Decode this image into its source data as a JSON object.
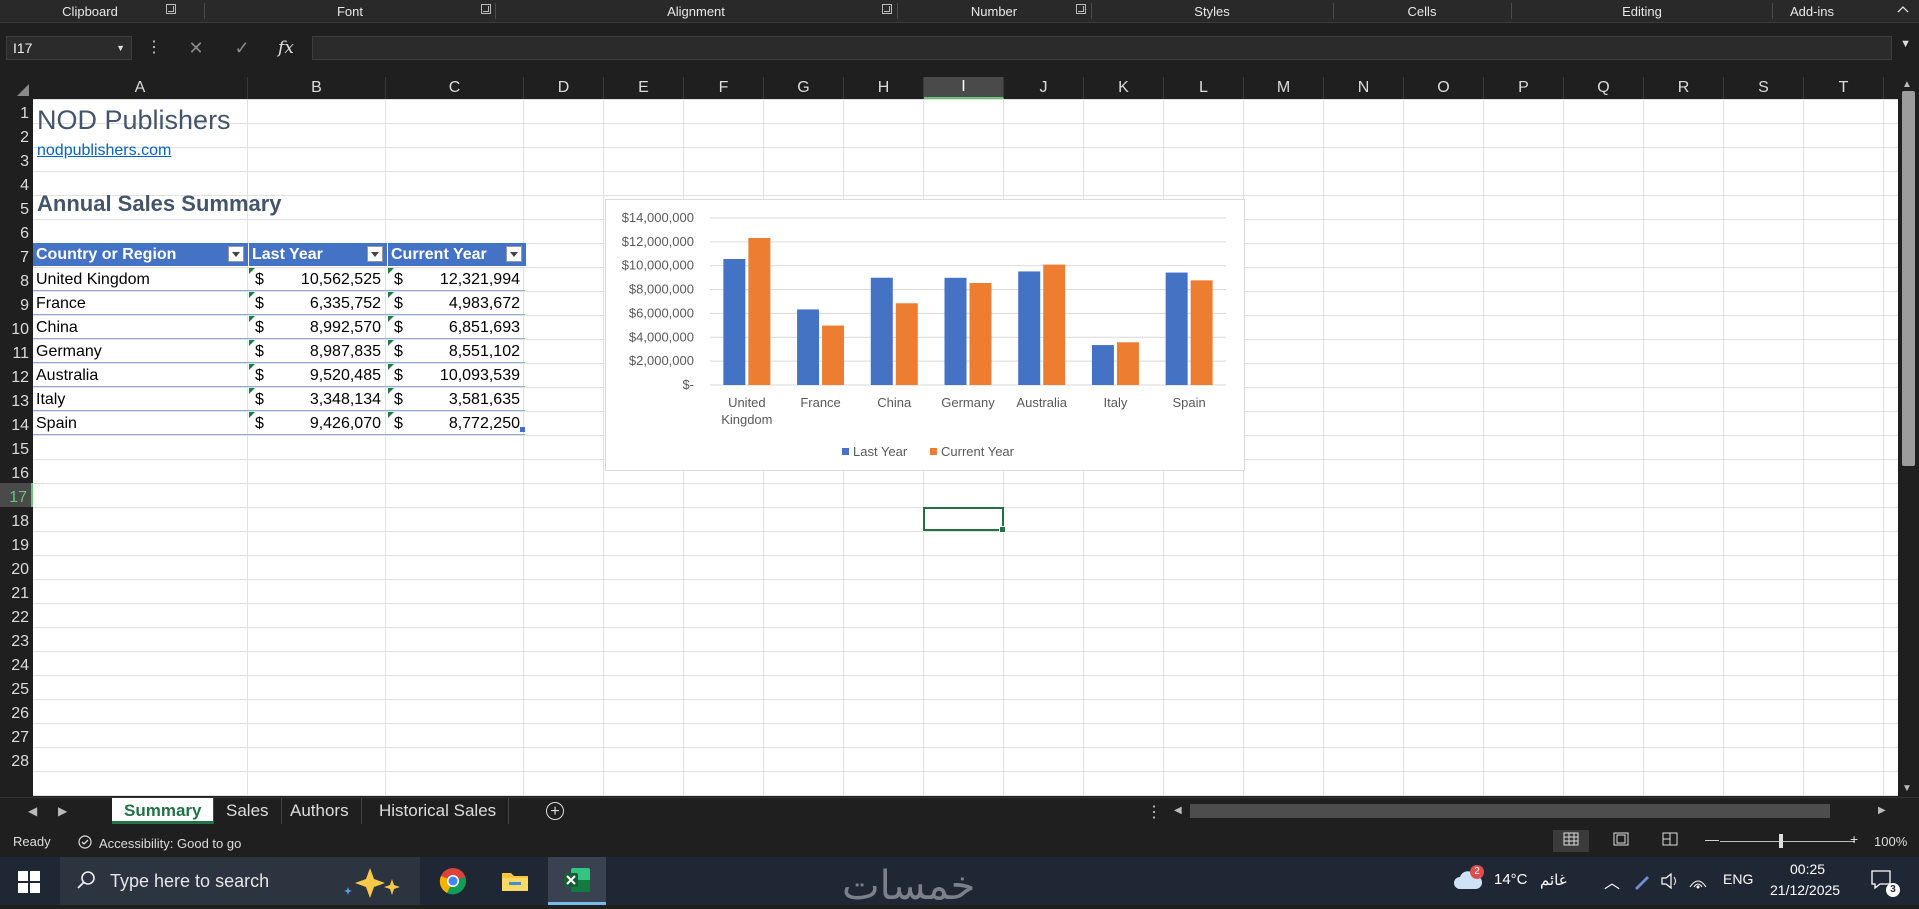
{
  "ribbon": {
    "groups": [
      "Clipboard",
      "Font",
      "Alignment",
      "Number",
      "Styles",
      "Cells",
      "Editing",
      "Add-ins"
    ]
  },
  "formula_bar": {
    "name_box": "I17",
    "cancel_glyph": "✕",
    "enter_glyph": "✓",
    "fx_glyph": "fx",
    "formula": ""
  },
  "columns": [
    "A",
    "B",
    "C",
    "D",
    "E",
    "F",
    "G",
    "H",
    "I",
    "J",
    "K",
    "L",
    "M",
    "N",
    "O",
    "P",
    "Q",
    "R",
    "S",
    "T"
  ],
  "rows": [
    "1",
    "2",
    "3",
    "4",
    "5",
    "6",
    "7",
    "8",
    "9",
    "10",
    "11",
    "12",
    "13",
    "14",
    "15",
    "16",
    "17",
    "18",
    "19",
    "20",
    "21",
    "22",
    "23",
    "24",
    "25",
    "26",
    "27",
    "28"
  ],
  "selected": {
    "column": "I",
    "row": "17"
  },
  "sheet": {
    "company_name": "NOD Publishers",
    "website": "nodpublishers.com",
    "table_title": "Annual Sales Summary",
    "table": {
      "headers": [
        "Country or Region",
        "Last Year",
        "Current Year"
      ],
      "currency_symbol": "$",
      "rows": [
        {
          "country": "United Kingdom",
          "last": "10,562,525",
          "current": "12,321,994"
        },
        {
          "country": "France",
          "last": "6,335,752",
          "current": "4,983,672"
        },
        {
          "country": "China",
          "last": "8,992,570",
          "current": "6,851,693"
        },
        {
          "country": "Germany",
          "last": "8,987,835",
          "current": "8,551,102"
        },
        {
          "country": "Australia",
          "last": "9,520,485",
          "current": "10,093,539"
        },
        {
          "country": "Italy",
          "last": "3,348,134",
          "current": "3,581,635"
        },
        {
          "country": "Spain",
          "last": "9,426,070",
          "current": "8,772,250"
        }
      ]
    }
  },
  "chart_data": {
    "type": "bar",
    "categories": [
      "United Kingdom",
      "France",
      "China",
      "Germany",
      "Australia",
      "Italy",
      "Spain"
    ],
    "category_labels": [
      [
        "United",
        "Kingdom"
      ],
      [
        "France"
      ],
      [
        "China"
      ],
      [
        "Germany"
      ],
      [
        "Australia"
      ],
      [
        "Italy"
      ],
      [
        "Spain"
      ]
    ],
    "series": [
      {
        "name": "Last Year",
        "color": "#4472c4",
        "values": [
          10562525,
          6335752,
          8992570,
          8987835,
          9520485,
          3348134,
          9426070
        ]
      },
      {
        "name": "Current Year",
        "color": "#ed7d31",
        "values": [
          12321994,
          4983672,
          6851693,
          8551102,
          10093539,
          3581635,
          8772250
        ]
      }
    ],
    "ylim": [
      0,
      14000000
    ],
    "yticks": [
      0,
      2000000,
      4000000,
      6000000,
      8000000,
      10000000,
      12000000,
      14000000
    ],
    "ytick_labels": [
      "$-",
      "$2,000,000",
      "$4,000,000",
      "$6,000,000",
      "$8,000,000",
      "$10,000,000",
      "$12,000,000",
      "$14,000,000"
    ],
    "grid": true,
    "legend_position": "bottom"
  },
  "sheet_tabs": [
    "Summary",
    "Sales",
    "Authors",
    "Historical Sales"
  ],
  "active_tab": "Summary",
  "status": {
    "ready": "Ready",
    "accessibility": "Accessibility: Good to go",
    "zoom": "100%"
  },
  "taskbar": {
    "search_placeholder": "Type here to search",
    "watermark": "خمسات",
    "weather_badge": "2",
    "temperature": "14°C",
    "weather_text": "غائم",
    "language": "ENG",
    "time": "00:25",
    "date": "21/12/2025",
    "notifications": "3"
  }
}
